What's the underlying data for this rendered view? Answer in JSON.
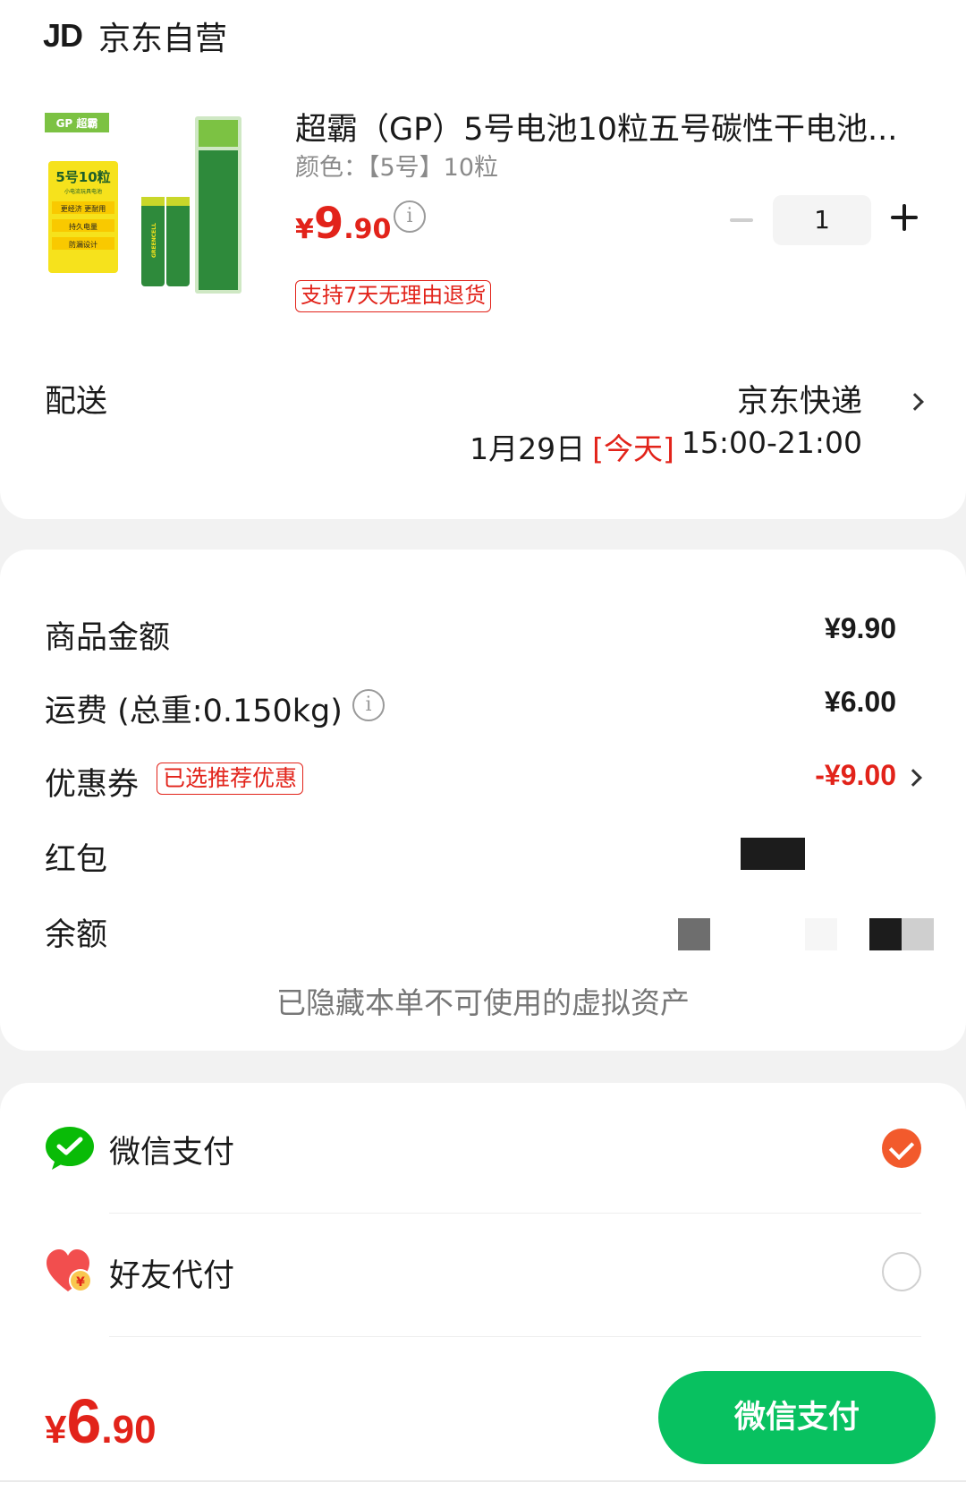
{
  "shop": {
    "logo_text": "JD",
    "name": "京东自营"
  },
  "product": {
    "title": "超霸（GP）5号电池10粒五号碳性干电池...",
    "spec": "颜色：【5号】10粒",
    "price_symbol": "¥",
    "price_int": "9",
    "price_dec": ".90",
    "info_icon_glyph": "i",
    "quantity": "1",
    "return_policy": "支持7天无理由退货",
    "image": {
      "brand": "GP 超霸",
      "pack_title": "5号10粒",
      "pack_sub": "小电流玩具电池",
      "badges": [
        "更经济 更耐用",
        "持久电量",
        "防漏设计"
      ],
      "cell_text": "GREENCELL"
    }
  },
  "delivery": {
    "label": "配送",
    "method": "京东快递",
    "date": "1月29日",
    "today": "[今天]",
    "time": "15:00-21:00"
  },
  "price_detail": {
    "goods": {
      "label": "商品金额",
      "value": "¥9.90"
    },
    "shipping": {
      "label": "运费 (总重:0.150kg)",
      "value": "¥6.00",
      "info_icon_glyph": "i"
    },
    "coupon": {
      "label": "优惠券",
      "tag": "已选推荐优惠",
      "value": "-¥9.00"
    },
    "hongbao": {
      "label": "红包"
    },
    "balance": {
      "label": "余额"
    },
    "hidden_note": "已隐藏本单不可使用的虚拟资产"
  },
  "payment": {
    "methods": [
      {
        "label": "微信支付",
        "icon": "wechat-pay-icon",
        "selected": true
      },
      {
        "label": "好友代付",
        "icon": "friend-pay-heart-icon",
        "selected": false
      }
    ]
  },
  "bottom": {
    "total_symbol": "¥",
    "total_int": "6",
    "total_dec": ".90",
    "pay_button": "微信支付"
  },
  "colors": {
    "accent_red": "#e2231a",
    "wechat_green": "#08c160",
    "check_orange": "#f25a2c"
  }
}
